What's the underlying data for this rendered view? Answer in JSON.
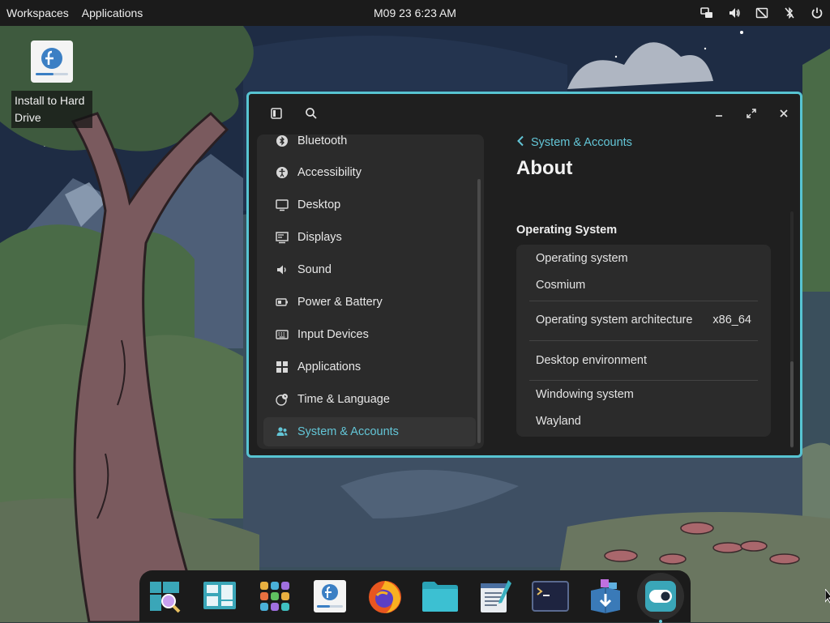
{
  "top_panel": {
    "workspaces_label": "Workspaces",
    "applications_label": "Applications",
    "clock": "M09 23 6:23 AM",
    "tray_icons": [
      "network-wired-icon",
      "volume-icon",
      "no-battery-icon",
      "bluetooth-disabled-icon",
      "power-icon"
    ]
  },
  "desktop": {
    "icon_label": "Install to Hard Drive",
    "icon": "fedora-installer-icon"
  },
  "window": {
    "header_icons": [
      "sidebar-toggle-icon",
      "search-icon",
      "minimize-icon",
      "maximize-icon",
      "close-icon"
    ],
    "sidebar": {
      "items": [
        {
          "label": "Bluetooth",
          "icon": "bluetooth-icon"
        },
        {
          "label": "Accessibility",
          "icon": "accessibility-icon"
        },
        {
          "label": "Desktop",
          "icon": "monitor-icon"
        },
        {
          "label": "Displays",
          "icon": "display-icon"
        },
        {
          "label": "Sound",
          "icon": "speaker-icon"
        },
        {
          "label": "Power & Battery",
          "icon": "battery-icon"
        },
        {
          "label": "Input Devices",
          "icon": "keyboard-icon"
        },
        {
          "label": "Applications",
          "icon": "apps-grid-icon"
        },
        {
          "label": "Time & Language",
          "icon": "globe-clock-icon"
        },
        {
          "label": "System & Accounts",
          "icon": "users-icon",
          "active": true
        }
      ]
    },
    "content": {
      "back_label": "System & Accounts",
      "title": "About",
      "section_title": "Operating System",
      "rows": {
        "os_label": "Operating system",
        "os_value": "Cosmium",
        "arch_label": "Operating system architecture",
        "arch_value": "x86_64",
        "desktop_env_label": "Desktop environment",
        "windowing_label": "Windowing system",
        "windowing_value": "Wayland"
      }
    }
  },
  "dock": {
    "items": [
      "launcher-search-icon",
      "workspaces-icon",
      "app-grid-icon",
      "fedora-installer-icon",
      "firefox-icon",
      "files-folder-icon",
      "text-editor-icon",
      "terminal-icon",
      "software-store-icon",
      "settings-toggle-icon"
    ],
    "active_item": "settings-toggle-icon"
  },
  "colors": {
    "accent": "#63c5d6",
    "window_border": "#57c4d2",
    "panel_bg": "#1b1b1b",
    "window_bg": "#1f1f1f",
    "card_bg": "#2b2b2b"
  }
}
